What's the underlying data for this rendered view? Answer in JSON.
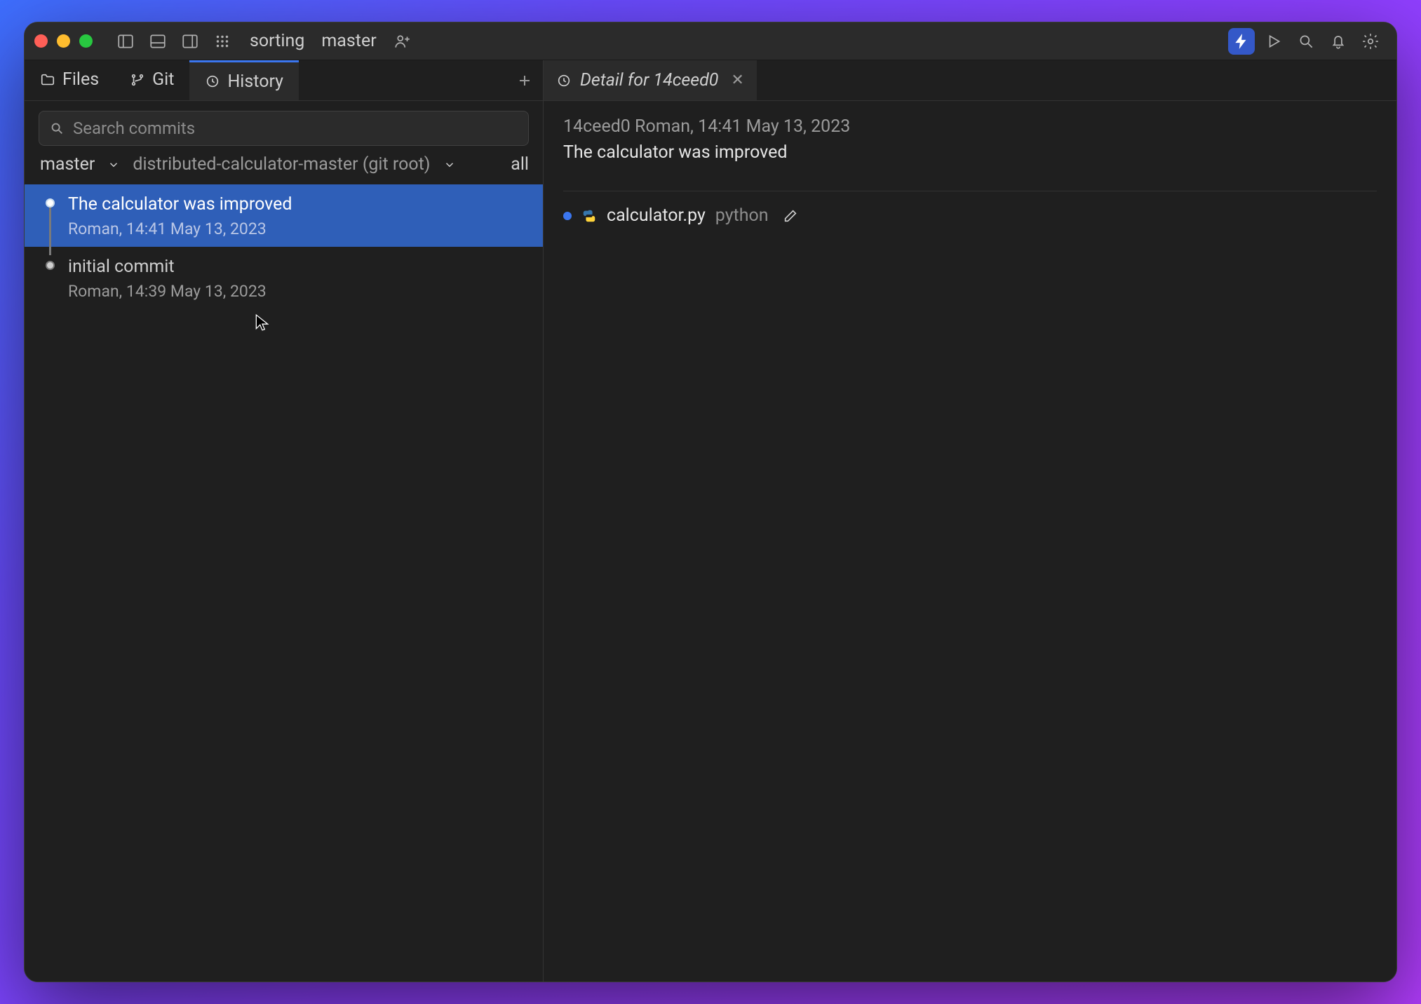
{
  "titlebar": {
    "project": "sorting",
    "branch": "master"
  },
  "sidebarTabs": {
    "files": "Files",
    "git": "Git",
    "history": "History"
  },
  "search": {
    "placeholder": "Search commits"
  },
  "filters": {
    "branch": "master",
    "root": "distributed-calculator-master (git root)",
    "all": "all"
  },
  "commits": [
    {
      "msg": "The calculator was improved",
      "meta": "Roman, 14:41 May 13, 2023",
      "selected": true
    },
    {
      "msg": "initial commit",
      "meta": "Roman, 14:39 May 13, 2023",
      "selected": false
    }
  ],
  "detail": {
    "tabTitle": "Detail for 14ceed0",
    "hdr": "14ceed0 Roman, 14:41 May 13, 2023",
    "title": "The calculator was improved",
    "file": {
      "name": "calculator.py",
      "dir": "python"
    }
  }
}
